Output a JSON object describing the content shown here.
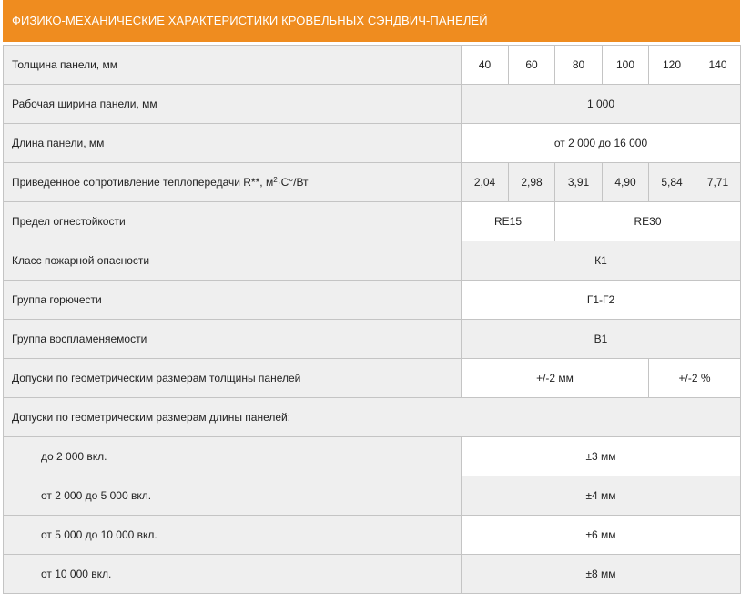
{
  "title": "ФИЗИКО-МЕХАНИЧЕСКИЕ ХАРАКТЕРИСТИКИ КРОВЕЛЬНЫХ СЭНДВИЧ-ПАНЕЛЕЙ",
  "rows": {
    "thickness": {
      "label": "Толщина панели, мм",
      "values": [
        "40",
        "60",
        "80",
        "100",
        "120",
        "140"
      ]
    },
    "width": {
      "label": "Рабочая ширина панели, мм",
      "value": "1 000"
    },
    "length": {
      "label": "Длина панели, мм",
      "value": "от 2 000 до 16 000"
    },
    "resistance": {
      "label_pre": "Приведенное сопротивление теплопередачи R**, м",
      "label_sup": "2",
      "label_post": "·С°/Вт",
      "values": [
        "2,04",
        "2,98",
        "3,91",
        "4,90",
        "5,84",
        "7,71"
      ]
    },
    "fire_resistance": {
      "label": "Предел огнестойкости",
      "values": [
        "RE15",
        "RE30"
      ]
    },
    "fire_class": {
      "label": "Класс пожарной опасности",
      "value": "К1"
    },
    "combustibility": {
      "label": "Группа горючести",
      "value": "Г1-Г2"
    },
    "flammability": {
      "label": "Группа воспламеняемости",
      "value": "В1"
    },
    "thickness_tolerance": {
      "label": "Допуски по геометрическим размерам толщины панелей",
      "values": [
        "+/-2 мм",
        "+/-2 %"
      ]
    },
    "length_tolerance": {
      "label": "Допуски по геометрическим размерам длины панелей:",
      "items": [
        {
          "label": "до 2 000 вкл.",
          "value": "±3 мм"
        },
        {
          "label": "от 2 000 до 5 000 вкл.",
          "value": "±4 мм"
        },
        {
          "label": "от 5 000 до 10 000 вкл.",
          "value": "±6 мм"
        },
        {
          "label": "от 10 000 вкл.",
          "value": "±8 мм"
        }
      ]
    }
  },
  "colors": {
    "header_bg": "#ef8c1f",
    "cell_bg": "#efefef",
    "border": "#c4c4c4"
  }
}
